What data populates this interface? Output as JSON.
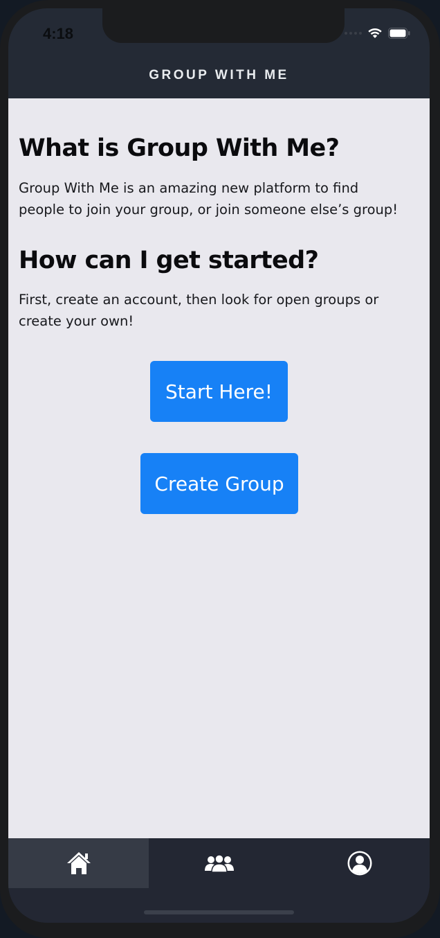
{
  "status_bar": {
    "time": "4:18"
  },
  "header": {
    "title": "GROUP WITH ME"
  },
  "main": {
    "section1": {
      "heading": "What is Group With Me?",
      "body_line1": "Group With Me is an amazing new platform to find",
      "body_line2": "people to join your group, or join someone else’s group!"
    },
    "section2": {
      "heading": "How can I get started?",
      "body_line1": "First, create an account, then look for open groups or",
      "body_line2": "create your own!"
    },
    "buttons": {
      "start_label": "Start Here!",
      "create_group_label": "Create Group"
    }
  },
  "tab_bar": {
    "tabs": [
      {
        "icon": "home-icon",
        "active": true
      },
      {
        "icon": "users-group-icon",
        "active": false
      },
      {
        "icon": "profile-icon",
        "active": false
      }
    ]
  },
  "colors": {
    "accent": "#1781f6",
    "header_bg": "#242a35",
    "content_bg": "#e9e8ee",
    "tab_active_bg": "#363b46"
  }
}
